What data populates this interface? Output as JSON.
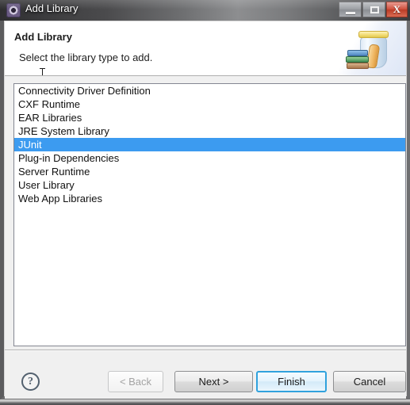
{
  "window": {
    "title": "Add Library",
    "icon": "eclipse-gear-icon",
    "controls": {
      "minimize": "–",
      "maximize": "□",
      "close": "X"
    }
  },
  "header": {
    "title": "Add Library",
    "description": "Select the library type to add.",
    "art_icon": "library-jar-books-icon"
  },
  "library_list": {
    "name": "library-type-list",
    "selected": "JUnit",
    "items": [
      {
        "label": "Connectivity Driver Definition",
        "selected": false
      },
      {
        "label": "CXF Runtime",
        "selected": false
      },
      {
        "label": "EAR Libraries",
        "selected": false
      },
      {
        "label": "JRE System Library",
        "selected": false
      },
      {
        "label": "JUnit",
        "selected": true
      },
      {
        "label": "Plug-in Dependencies",
        "selected": false
      },
      {
        "label": "Server Runtime",
        "selected": false
      },
      {
        "label": "User Library",
        "selected": false
      },
      {
        "label": "Web App Libraries",
        "selected": false
      }
    ]
  },
  "buttons": {
    "help": "?",
    "back": "< Back",
    "next": "Next >",
    "finish": "Finish",
    "cancel": "Cancel",
    "back_enabled": false,
    "default_button": "Finish"
  },
  "colors": {
    "selection_blue": "#3c9bf0",
    "default_button_border": "#30a2dd",
    "dialog_background": "#f0f0f0",
    "close_button_red": "#cf4f3c",
    "titlebar_dark": "#3b3b3d"
  }
}
